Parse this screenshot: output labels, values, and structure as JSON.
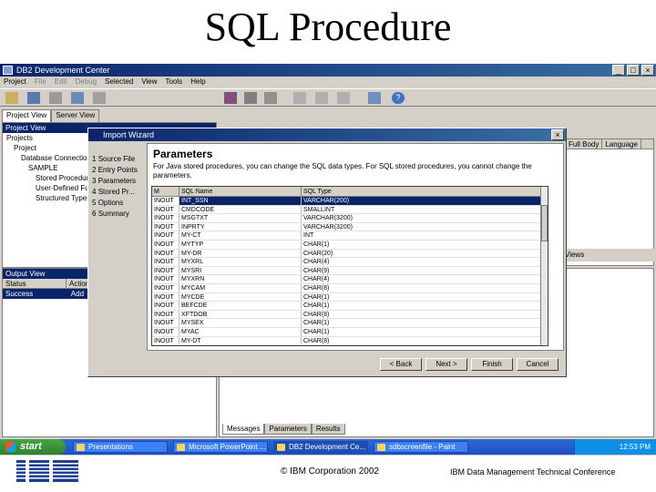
{
  "slide": {
    "title": "SQL Procedure",
    "copyright": "© IBM Corporation 2002",
    "conference": "IBM Data Management Technical Conference"
  },
  "app": {
    "title": "DB2 Development Center",
    "menus": [
      "Project",
      "File",
      "Edit",
      "Debug",
      "Selected",
      "View",
      "Tools",
      "Help"
    ],
    "project_tabs": [
      "Project View",
      "Server View"
    ],
    "project_panel_title": "Project View",
    "tree": [
      "Projects",
      "Project",
      "Database Connections",
      "SAMPLE",
      "Stored Procedures",
      "User-Defined Functions",
      "Structured Types"
    ],
    "right_columns": [
      "Full Body",
      "Language"
    ],
    "right_footer": "Views",
    "output_panel_title": "Output View",
    "output_columns": [
      "Status",
      "Action"
    ],
    "output_rows": [
      {
        "status": "Success",
        "action": "Add"
      }
    ],
    "message_tabs": [
      "Messages",
      "Parameters",
      "Results"
    ]
  },
  "dialog": {
    "title": "Import Wizard",
    "steps": [
      {
        "num": "1",
        "label": "Source File"
      },
      {
        "num": "2",
        "label": "Entry Points"
      },
      {
        "num": "3",
        "label": "Parameters"
      },
      {
        "num": "4",
        "label": "Stored Pr..."
      },
      {
        "num": "5",
        "label": "Options"
      },
      {
        "num": "6",
        "label": "Summary"
      }
    ],
    "heading": "Parameters",
    "description": "For Java stored procedures, you can change the SQL data types.  For SQL stored procedures, you cannot change the parameters.",
    "columns": [
      "M",
      "SQL Name",
      "SQL Type"
    ],
    "rows": [
      {
        "mode": "INOUT",
        "name": "INT_SSN",
        "type": "VARCHAR(200)"
      },
      {
        "mode": "INOUT",
        "name": "CMDCODE",
        "type": "SMALLINT"
      },
      {
        "mode": "INOUT",
        "name": "MSGTXT",
        "type": "VARCHAR(3200)"
      },
      {
        "mode": "INOUT",
        "name": "INPRTY",
        "type": "VARCHAR(3200)"
      },
      {
        "mode": "INOUT",
        "name": "MY-CT",
        "type": "INT"
      },
      {
        "mode": "INOUT",
        "name": "MYTYP",
        "type": "CHAR(1)"
      },
      {
        "mode": "INOUT",
        "name": "MY-DR",
        "type": "CHAR(20)"
      },
      {
        "mode": "INOUT",
        "name": "MYXRL",
        "type": "CHAR(4)"
      },
      {
        "mode": "INOUT",
        "name": "MYSRI",
        "type": "CHAR(9)"
      },
      {
        "mode": "INOUT",
        "name": "MYXRN",
        "type": "CHAR(4)"
      },
      {
        "mode": "INOUT",
        "name": "MYCAM",
        "type": "CHAR(8)"
      },
      {
        "mode": "INOUT",
        "name": "MYCDE",
        "type": "CHAR(1)"
      },
      {
        "mode": "INOUT",
        "name": "BEFCDE",
        "type": "CHAR(1)"
      },
      {
        "mode": "INOUT",
        "name": "XFTDOB",
        "type": "CHAR(8)"
      },
      {
        "mode": "INOUT",
        "name": "MYSEX",
        "type": "CHAR(1)"
      },
      {
        "mode": "INOUT",
        "name": "MYAC",
        "type": "CHAR(1)"
      },
      {
        "mode": "INOUT",
        "name": "MY-DT",
        "type": "CHAR(8)"
      },
      {
        "mode": "INOUT",
        "name": "MYXRU",
        "type": "CHAR(8)"
      }
    ],
    "buttons": {
      "back": "< Back",
      "next": "Next >",
      "finish": "Finish",
      "cancel": "Cancel"
    }
  },
  "taskbar": {
    "start": "start",
    "items": [
      "Presentations",
      "Microsoft PowerPoint ...",
      "DB2 Development Ce...",
      "sdbscreenfile - Paint"
    ],
    "clock": "12:53 PM"
  }
}
